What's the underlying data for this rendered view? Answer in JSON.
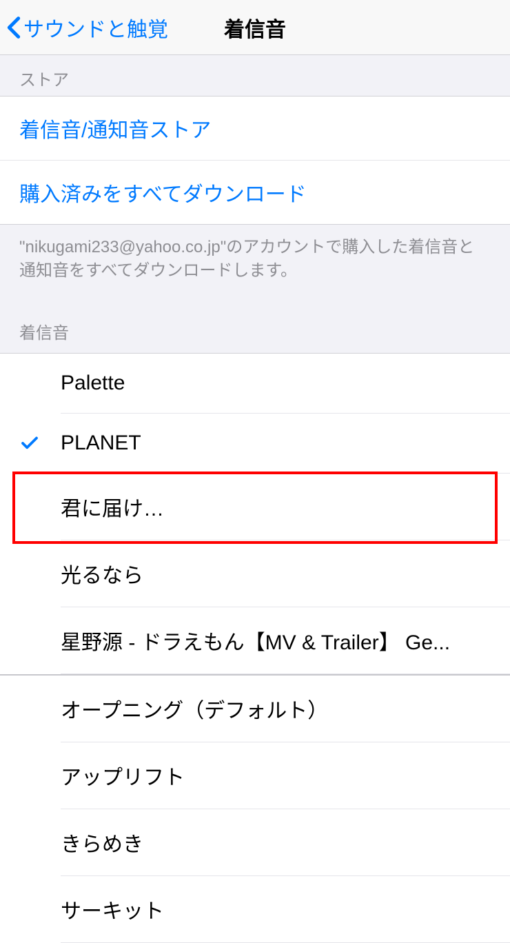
{
  "header": {
    "back_label": "サウンドと触覚",
    "title": "着信音"
  },
  "store_section": {
    "header": "ストア",
    "items": [
      {
        "label": "着信音/通知音ストア"
      },
      {
        "label": "購入済みをすべてダウンロード"
      }
    ],
    "footer": "\"nikugami233@yahoo.co.jp\"のアカウントで購入した着信音と通知音をすべてダウンロードします。"
  },
  "ringtone_section": {
    "header": "着信音",
    "selected_index": 1,
    "highlighted_index": 2,
    "custom_items": [
      {
        "label": "Palette"
      },
      {
        "label": "PLANET"
      },
      {
        "label": "君に届け…"
      },
      {
        "label": "光るなら"
      },
      {
        "label": "星野源 - ドラえもん【MV & Trailer】 Ge..."
      }
    ],
    "default_items": [
      {
        "label": "オープニング（デフォルト）"
      },
      {
        "label": "アップリフト"
      },
      {
        "label": "きらめき"
      },
      {
        "label": "サーキット"
      }
    ]
  },
  "colors": {
    "accent": "#007aff",
    "highlight": "#ff0000"
  }
}
